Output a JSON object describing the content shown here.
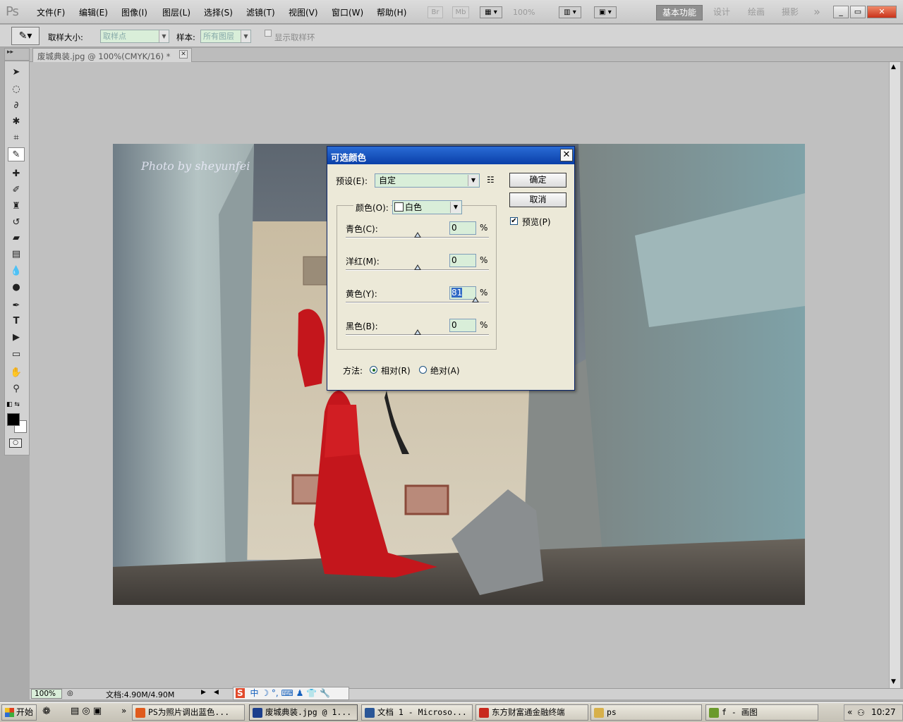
{
  "app": {
    "logo": "Ps"
  },
  "menus": [
    "文件(F)",
    "编辑(E)",
    "图像(I)",
    "图层(L)",
    "选择(S)",
    "滤镜(T)",
    "视图(V)",
    "窗口(W)",
    "帮助(H)"
  ],
  "app_toolbar": {
    "br": "Br",
    "mb": "Mb",
    "zoom": "100%"
  },
  "workspaces": {
    "active": "基本功能",
    "items": [
      "设计",
      "绘画",
      "摄影"
    ],
    "more": "»"
  },
  "window_controls": {
    "min": "_",
    "restore": "▭",
    "close": "✕"
  },
  "options": {
    "sample_size_label": "取样大小:",
    "sample_size_value": "取样点",
    "sample_label": "样本:",
    "sample_value": "所有图层",
    "ring_label": "显示取样环"
  },
  "document_tab": {
    "title": "废城典装.jpg @ 100%(CMYK/16) *",
    "close": "✕"
  },
  "photo": {
    "watermark": "Photo by sheyunfei"
  },
  "status": {
    "zoom": "100%",
    "doc_size": "文档:4.90M/4.90M"
  },
  "dialog": {
    "title": "可选颜色",
    "preset_label": "预设(E):",
    "preset_value": "自定",
    "ok": "确定",
    "cancel": "取消",
    "preview_label": "预览(P)",
    "colors_label": "颜色(O):",
    "colors_value": "白色",
    "percent": "%",
    "sliders": [
      {
        "label": "青色(C):",
        "value": "0",
        "level": 0
      },
      {
        "label": "洋红(M):",
        "value": "0",
        "level": 0
      },
      {
        "label": "黄色(Y):",
        "value": "81",
        "level": 81
      },
      {
        "label": "黑色(B):",
        "value": "0",
        "level": 0
      }
    ],
    "method_label": "方法:",
    "relative": "相对(R)",
    "absolute": "绝对(A)"
  },
  "taskbar": {
    "start": "开始",
    "tasks": [
      {
        "label": "PS为照片调出蓝色...",
        "color": "#e05a1c"
      },
      {
        "label": "废城典装.jpg @ 1...",
        "color": "#1c3f8c",
        "active": true
      },
      {
        "label": "文档 1 - Microso...",
        "color": "#2b5797"
      },
      {
        "label": "东方财富通金融终端",
        "color": "#c8291d"
      },
      {
        "label": "ps",
        "color": "#d7b04a"
      },
      {
        "label": "f - 画图",
        "color": "#6b9a2c"
      }
    ],
    "clock": "10:27"
  },
  "ime": {
    "s": "S",
    "zh": "中"
  }
}
